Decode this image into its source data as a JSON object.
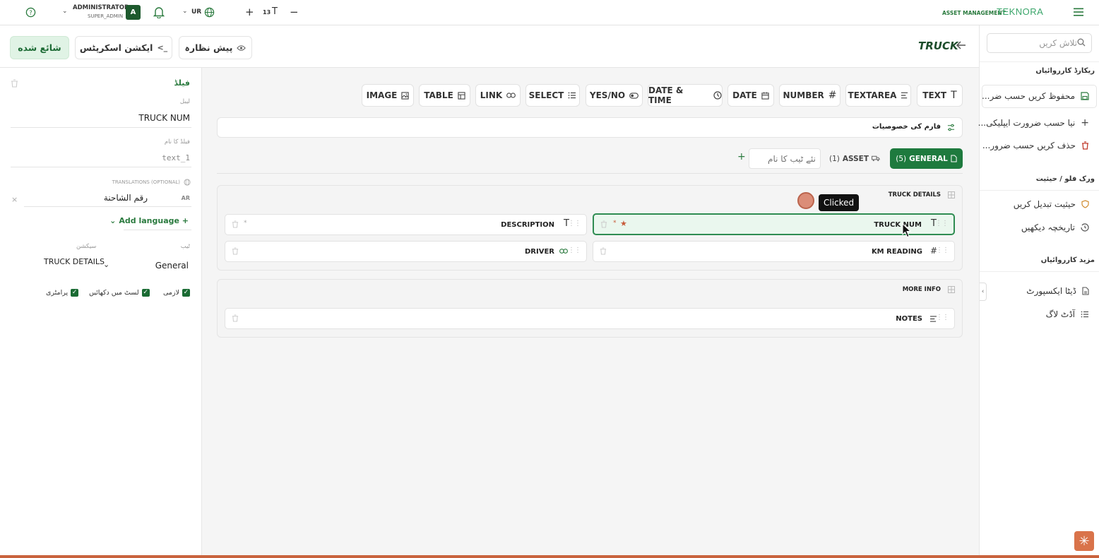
{
  "topbar": {
    "help_icon": "question-circle-icon",
    "user_name": "ADMINISTRATOR",
    "user_role": "SUPER_ADMIN",
    "avatar_letter": "A",
    "language": "UR",
    "font_size": "13",
    "plus": "+",
    "minus": "−",
    "brand_prefix": "ASSET MANAGEMENT",
    "brand_name": "TEKNORA"
  },
  "header": {
    "published_label": "شائع شده",
    "actions_label": "ایکشن اسکرپٹس",
    "preview_label": "پیش نظارہ",
    "page_title": "TRUCK"
  },
  "field_panel": {
    "section_title": "فیلڈ",
    "label_caption": "لیبل",
    "label_value": "TRUCK NUM",
    "name_caption": "فیلڈ کا نام",
    "name_value": "text_1",
    "translations_caption": "TRANSLATIONS (OPTIONAL)",
    "translation_lang": "AR",
    "translation_value": "رقم الشاحنة",
    "add_language": "Add language +",
    "tab_caption": "ٹیب",
    "section_caption": "سیکشن",
    "tab_value": "General",
    "section_value": "TRUCK DETAILS",
    "required_label": "لازمی",
    "show_in_list_label": "لسٹ میں دکھائیں",
    "parameter_label": "پرامٹری"
  },
  "field_types": [
    "TEXT",
    "TEXTAREA",
    "NUMBER",
    "DATE",
    "DATE & TIME",
    "YES/NO",
    "SELECT",
    "LINK",
    "TABLE",
    "IMAGE"
  ],
  "form_properties": "فارم کی خصوصیات",
  "tabs": {
    "general_label": "GENERAL",
    "general_count": "(5)",
    "asset_label": "ASSET",
    "asset_count": "(1)",
    "new_tab_placeholder": "نئے ٹیب کا نام",
    "add": "+"
  },
  "sections": {
    "truck_details_title": "TRUCK DETAILS",
    "more_info_title": "MORE INFO",
    "fields": {
      "truck_num": "TRUCK NUM",
      "description": "DESCRIPTION",
      "km_reading": "KM READING",
      "driver": "DRIVER",
      "notes": "NOTES"
    }
  },
  "overlay": {
    "clicked_label": "Clicked"
  },
  "sidebar": {
    "search_placeholder": "تلاش کریں",
    "records_heading": "ریکارڈ کارروائیاں",
    "save_as_needed": "محفوظ کریں حسب ضر...",
    "new_as_needed": "نیا حسب ضرورت ایپلیکی...",
    "delete_as_needed": "حذف کریں حسب ضرور...",
    "workflow_heading": "ورک فلو / حیثیت",
    "change_status": "حیثیت تبدیل کریں",
    "view_history": "تاریخچہ دیکھیں",
    "more_heading": "مزید کارروائیاں",
    "data_export": "ڈیٹا ایکسپورٹ",
    "audit_log": "آڈٹ لاگ"
  }
}
